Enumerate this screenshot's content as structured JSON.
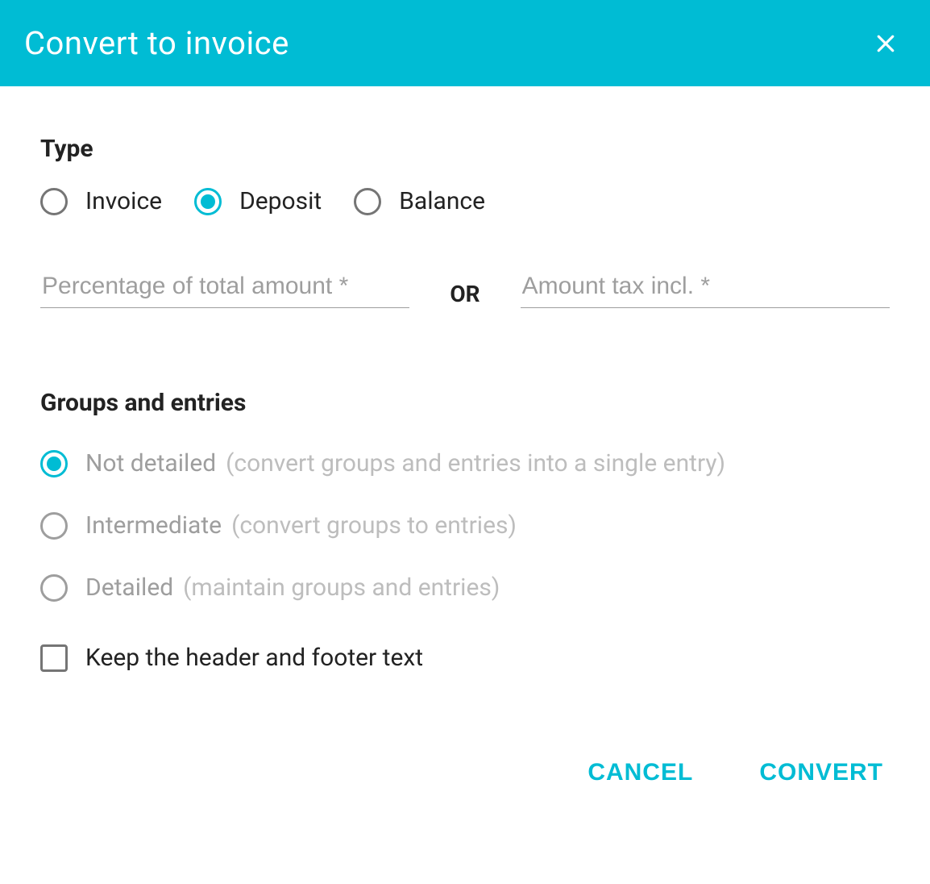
{
  "header": {
    "title": "Convert to invoice"
  },
  "type": {
    "title": "Type",
    "options": {
      "invoice": "Invoice",
      "deposit": "Deposit",
      "balance": "Balance"
    }
  },
  "inputs": {
    "percentage_placeholder": "Percentage of total amount *",
    "or": "OR",
    "amount_placeholder": "Amount tax incl. *"
  },
  "groups": {
    "title": "Groups and entries",
    "not_detailed": {
      "label": "Not detailed",
      "hint": "(convert groups and entries into a single entry)"
    },
    "intermediate": {
      "label": "Intermediate",
      "hint": "(convert groups to entries)"
    },
    "detailed": {
      "label": "Detailed",
      "hint": "(maintain groups and entries)"
    }
  },
  "checkbox": {
    "label": "Keep the header and footer text"
  },
  "actions": {
    "cancel": "CANCEL",
    "convert": "CONVERT"
  }
}
